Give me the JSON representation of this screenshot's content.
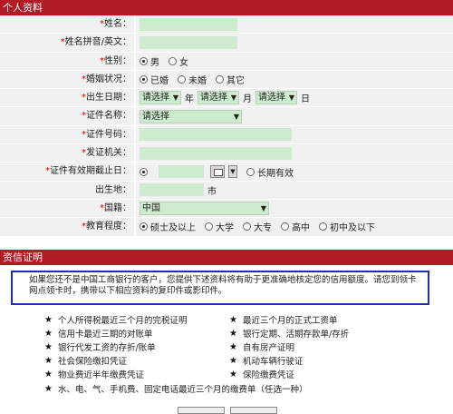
{
  "section1": {
    "title": "个人资料"
  },
  "fields": {
    "name": {
      "label": "姓名："
    },
    "pinyin": {
      "label": "姓名拼音/英文："
    },
    "gender": {
      "label": "性别：",
      "options": [
        "男",
        "女"
      ],
      "selected": "男"
    },
    "marital": {
      "label": "婚姻状况：",
      "options": [
        "已婚",
        "未婚",
        "其它"
      ],
      "selected": "已婚"
    },
    "birthday": {
      "label": "出生日期：",
      "year_sel": "请选择",
      "year_unit": "年",
      "month_sel": "请选择",
      "month_unit": "月",
      "day_sel": "请选择",
      "day_unit": "日"
    },
    "id_type": {
      "label": "证件名称：",
      "value": "请选择"
    },
    "id_number": {
      "label": "证件号码："
    },
    "issuer": {
      "label": "发证机关："
    },
    "id_expiry": {
      "label": "证件有效期截止日：",
      "long_term": "长期有效"
    },
    "birthplace": {
      "label": "出生地：",
      "suffix": "市"
    },
    "nationality": {
      "label": "国籍：",
      "value": "中国"
    },
    "education": {
      "label": "教育程度：",
      "options": [
        "硕士及以上",
        "大学",
        "大专",
        "高中",
        "初中及以下"
      ],
      "selected": "硕士及以上"
    }
  },
  "section2": {
    "title": "资信证明",
    "notice": "如果您还不是中国工商银行的客户，您提供下述资料将有助于更准确地核定您的信用额度。请您到领卡网点领卡时，携带以下相应资料的复印件或影印件。"
  },
  "docs_left": [
    "个人所得税最近三个月的完税证明",
    "信用卡最近三期的对账单",
    "银行代发工资的存折/账单",
    "社会保险缴扣凭证",
    "物业费近半年缴费凭证",
    "水、电、气、手机费、固定电话最近三个月的缴费单（任选一种）"
  ],
  "docs_right": [
    "最近三个月的正式工资单",
    "银行定期、活期存款单/存折",
    "自有房产证明",
    "机动车辆行驶证",
    "保险缴费凭证"
  ],
  "icons": {
    "required_mark": "asterisk",
    "bullet": "star-icon",
    "calendar": "calendar-icon",
    "dropdown": "chevron-down-icon"
  },
  "colors": {
    "header_bg": "#b21a24",
    "input_bg": "#cdebcd",
    "notice_border": "#1b2fb0",
    "row_bg": "#f1f1f1"
  }
}
